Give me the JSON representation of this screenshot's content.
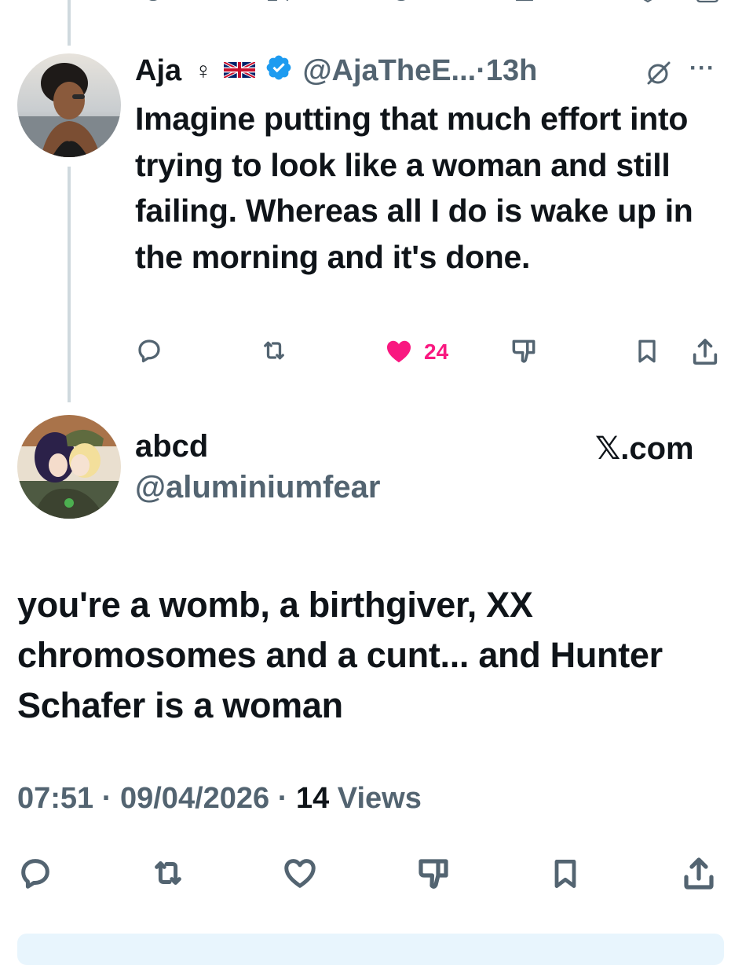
{
  "reply": {
    "display_name": "Aja",
    "venus_symbol": "♀",
    "flag": "🇬🇧",
    "handle": "@AjaTheE...",
    "dot": "·",
    "time": "13h",
    "more": "···",
    "text": "Imagine putting that much effort into trying to look like a woman and  still failing. Whereas all I do is wake up in the morning and it's done.",
    "likes_count": "24",
    "like_color": "#f91880",
    "verified_color": "#1d9bf0"
  },
  "main": {
    "display_name": "abcd",
    "handle": "@aluminiumfear",
    "brand": "𝕏.com",
    "text": "you're a womb, a birthgiver, XX chromosomes and a cunt... and Hunter Schafer is a woman",
    "time": "07:51",
    "date": "09/04/2026",
    "views_count": "14",
    "views_label": "Views",
    "separator": "·"
  },
  "icons": {
    "reply": "speech-bubble-icon",
    "repost": "repost-icon",
    "like": "heart-icon",
    "dislike": "thumbs-down-icon",
    "bookmark": "bookmark-icon",
    "share": "share-icon",
    "grok": "slashed-circle-icon"
  }
}
